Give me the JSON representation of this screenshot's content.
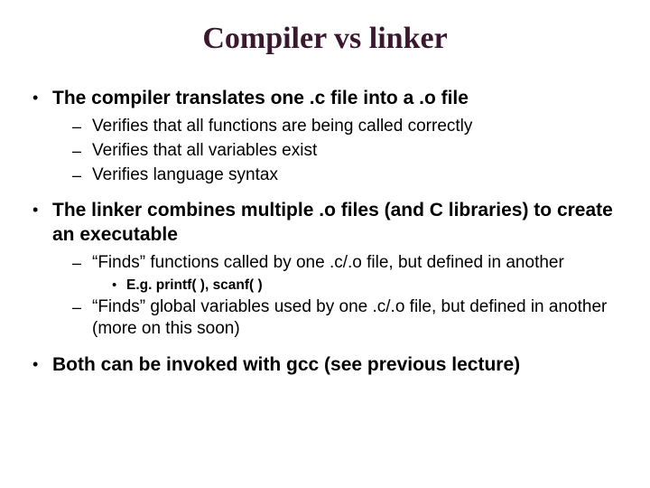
{
  "title": "Compiler vs linker",
  "bullets": [
    {
      "text": "The compiler translates one .c file into a .o file",
      "sub": [
        {
          "text": "Verifies that all functions are being called correctly"
        },
        {
          "text": "Verifies that all variables exist"
        },
        {
          "text": "Verifies language syntax"
        }
      ]
    },
    {
      "text": "The linker combines multiple .o files (and C libraries) to create an executable",
      "sub": [
        {
          "text": "“Finds” functions called by one .c/.o file, but defined in another",
          "sub": [
            {
              "text": "E.g. printf( ), scanf( )"
            }
          ]
        },
        {
          "text": "“Finds” global variables used by one .c/.o file, but defined in another (more on this soon)"
        }
      ]
    },
    {
      "text": "Both can be invoked with gcc (see previous lecture)"
    }
  ]
}
